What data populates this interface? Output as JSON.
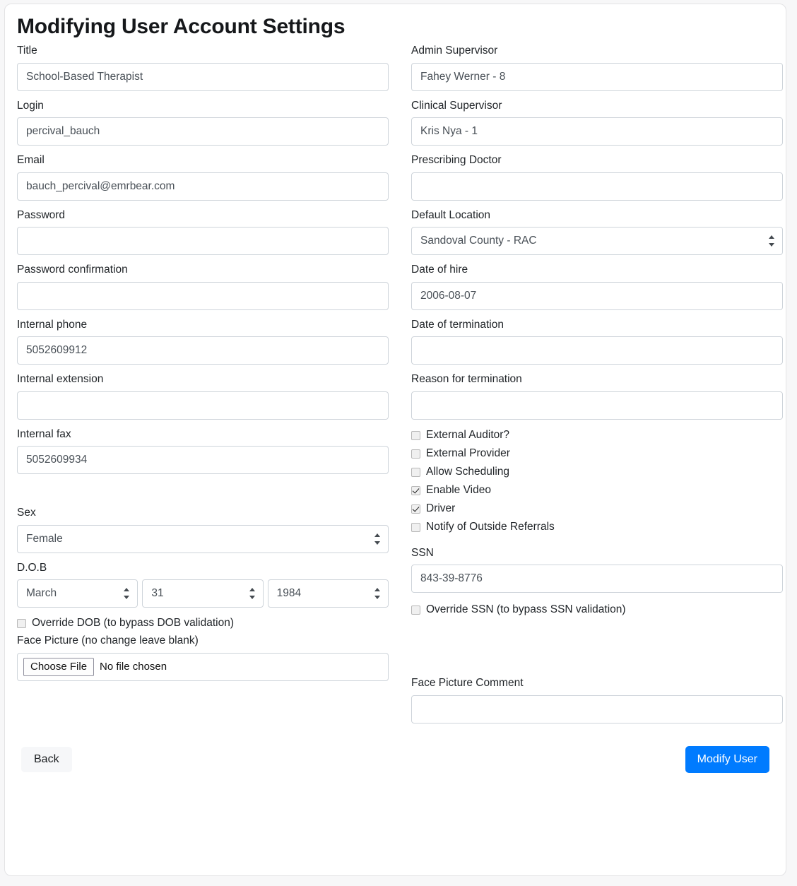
{
  "page": {
    "title": "Modifying User Account Settings",
    "accent_color": "#007bff",
    "back_label": "Back",
    "submit_label": "Modify User"
  },
  "left_column": {
    "title": {
      "label": "Title",
      "value": "School-Based Therapist"
    },
    "login": {
      "label": "Login",
      "value": "percival_bauch"
    },
    "email": {
      "label": "Email",
      "value": "bauch_percival@emrbear.com"
    },
    "password": {
      "label": "Password",
      "value": ""
    },
    "password_confirmation": {
      "label": "Password confirmation",
      "value": ""
    },
    "internal_phone": {
      "label": "Internal phone",
      "value": "5052609912"
    },
    "internal_extension": {
      "label": "Internal extension",
      "value": ""
    },
    "internal_fax": {
      "label": "Internal fax",
      "value": "5052609934"
    },
    "sex": {
      "label": "Sex",
      "value": "Female"
    },
    "dob": {
      "label": "D.O.B",
      "month": "March",
      "day": "31",
      "year": "1984"
    },
    "override_dob": {
      "label": "Override DOB (to bypass DOB validation)",
      "checked": false
    },
    "face_picture": {
      "label": "Face Picture (no change leave blank)",
      "button_label": "Choose File",
      "file_status": "No file chosen"
    }
  },
  "right_column": {
    "admin_supervisor": {
      "label": "Admin Supervisor",
      "value": "Fahey Werner - 8"
    },
    "clinical_supervisor": {
      "label": "Clinical Supervisor",
      "value": "Kris Nya - 1"
    },
    "prescribing_doctor": {
      "label": "Prescribing Doctor",
      "value": ""
    },
    "default_location": {
      "label": "Default Location",
      "value": "Sandoval County - RAC"
    },
    "date_of_hire": {
      "label": "Date of hire",
      "value": "2006-08-07"
    },
    "date_of_termination": {
      "label": "Date of termination",
      "value": ""
    },
    "reason_for_termination": {
      "label": "Reason for termination",
      "value": ""
    },
    "flags": [
      {
        "label": "External Auditor?",
        "checked": false
      },
      {
        "label": "External Provider",
        "checked": false
      },
      {
        "label": "Allow Scheduling",
        "checked": false
      },
      {
        "label": "Enable Video",
        "checked": true
      },
      {
        "label": "Driver",
        "checked": true
      },
      {
        "label": "Notify of Outside Referrals",
        "checked": false
      }
    ],
    "ssn": {
      "label": "SSN",
      "value": "843-39-8776"
    },
    "override_ssn": {
      "label": "Override SSN (to bypass SSN validation)",
      "checked": false
    },
    "face_picture_comment": {
      "label": "Face Picture Comment",
      "value": ""
    }
  }
}
